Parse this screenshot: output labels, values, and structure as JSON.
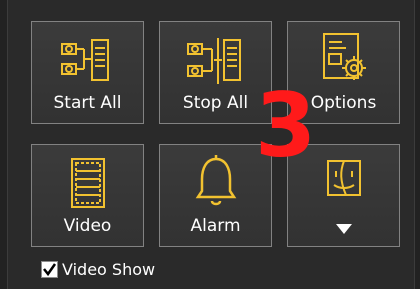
{
  "toolbar": {
    "tiles": [
      {
        "label": "Start All",
        "icon": "start-all-icon"
      },
      {
        "label": "Stop All",
        "icon": "stop-all-icon"
      },
      {
        "label": "Options",
        "icon": "options-icon"
      },
      {
        "label": "Video",
        "icon": "video-icon"
      },
      {
        "label": "Alarm",
        "icon": "alarm-bell-icon"
      },
      {
        "label": "",
        "icon": "finder-face-icon",
        "menu_indicator": "dropdown-arrow-icon"
      }
    ]
  },
  "overlay": {
    "step_number": "3",
    "color": "#ff1a1a"
  },
  "video_show": {
    "label": "Video Show",
    "checked": true
  }
}
